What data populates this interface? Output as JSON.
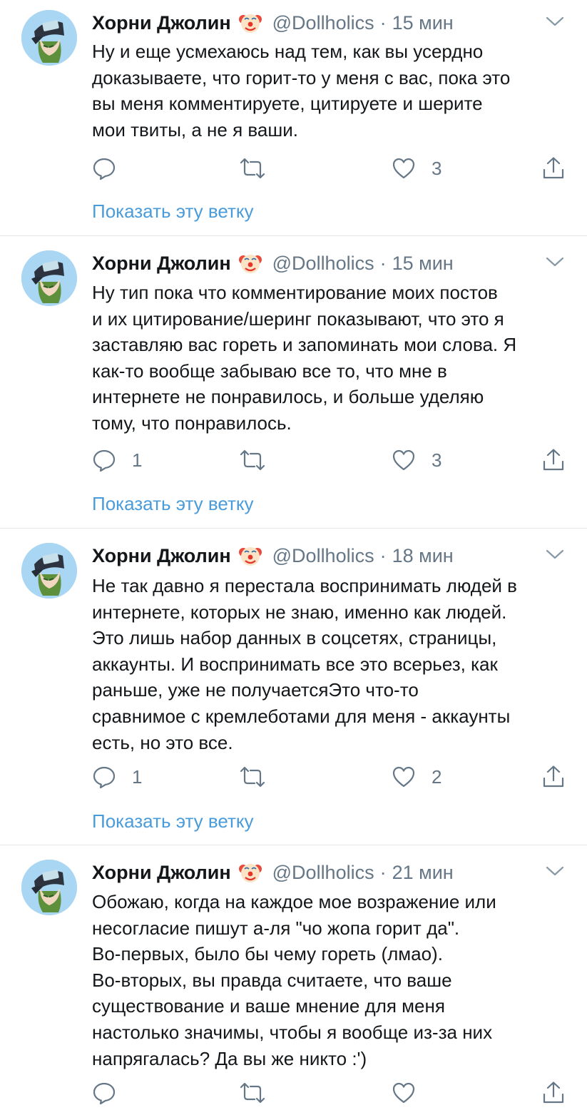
{
  "tweets": [
    {
      "author": "Хорни Джолин",
      "handle": "@Dollholics",
      "separator": "·",
      "time": "15 мин",
      "text": "Ну и еще усмехаюсь над тем, как вы усердно\nдоказываете, что горит-то у меня с вас, пока это\nвы меня комментируете, цитируете и шерите\nмои твиты, а не я ваши.",
      "reply_count": "",
      "like_count": "3",
      "thread_link": "Показать эту ветку",
      "icons": [
        "avatar-image",
        "clown-emoji",
        "chevron-down-icon",
        "reply-icon",
        "retweet-icon",
        "heart-icon",
        "share-icon"
      ]
    },
    {
      "author": "Хорни Джолин",
      "handle": "@Dollholics",
      "separator": "·",
      "time": "15 мин",
      "text": "Ну тип пока что комментирование моих постов\nи их цитирование/шеринг показывают, что это я\nзаставляю вас гореть и запоминать мои слова. Я\nкак-то вообще забываю все то, что мне в\nинтернете не понравилось, и больше уделяю\nтому, что понравилось.",
      "reply_count": "1",
      "like_count": "3",
      "thread_link": "Показать эту ветку"
    },
    {
      "author": "Хорни Джолин",
      "handle": "@Dollholics",
      "separator": "·",
      "time": "18 мин",
      "text": "Не так давно я перестала воспринимать людей в\nинтернете, которых не знаю, именно как людей.\nЭто лишь набор данных в соцсетях, страницы,\nаккаунты. И воспринимать все это всерьез, как\nраньше, уже не получаетсяЭто что-то\nсравнимое с кремлеботами для меня - аккаунты\nесть, но это все.",
      "reply_count": "1",
      "like_count": "2",
      "thread_link": "Показать эту ветку"
    },
    {
      "author": "Хорни Джолин",
      "handle": "@Dollholics",
      "separator": "·",
      "time": "21 мин",
      "text": "Обожаю, когда на каждое мое возражение или\nнесогласие пишут а-ля \"чо жопа горит да\".\nВо-первых, было бы чему гореть (лмао).\nВо-вторых, вы правда считаете, что ваше\nсуществование и ваше мнение для меня\nнастолько значимы, чтобы я вообще из-за них\nнапрягалась? Да вы же никто :')",
      "reply_count": "",
      "like_count": "",
      "thread_link": ""
    }
  ],
  "colors": {
    "name": "#14171a",
    "meta": "#657786",
    "link": "#4a9bd9",
    "divider": "#e3e7ea",
    "avatar_bg": "#a9d6f3"
  }
}
